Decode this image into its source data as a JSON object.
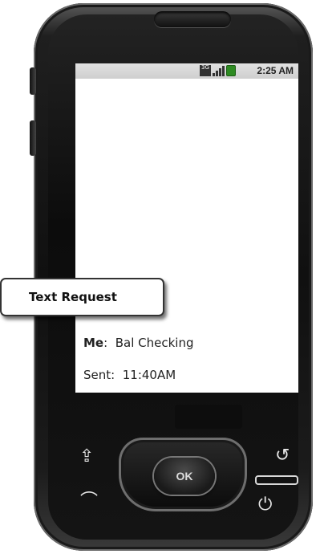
{
  "status_bar": {
    "network": "3G",
    "time": "2:25 AM",
    "battery_color": "#2e8b22"
  },
  "conversation": {
    "message_sender": "Me",
    "message_sender_suffix": ":",
    "message_text": "Bal Checking",
    "sent_label": "Sent:",
    "sent_time": "11:40AM"
  },
  "hardware": {
    "ok_label": "OK",
    "icons": {
      "menu": "menu-up-icon",
      "back": "back-arrow-icon",
      "call": "call-icon",
      "end_call": "end-call-icon"
    }
  },
  "callout": {
    "label": "Text Request"
  }
}
